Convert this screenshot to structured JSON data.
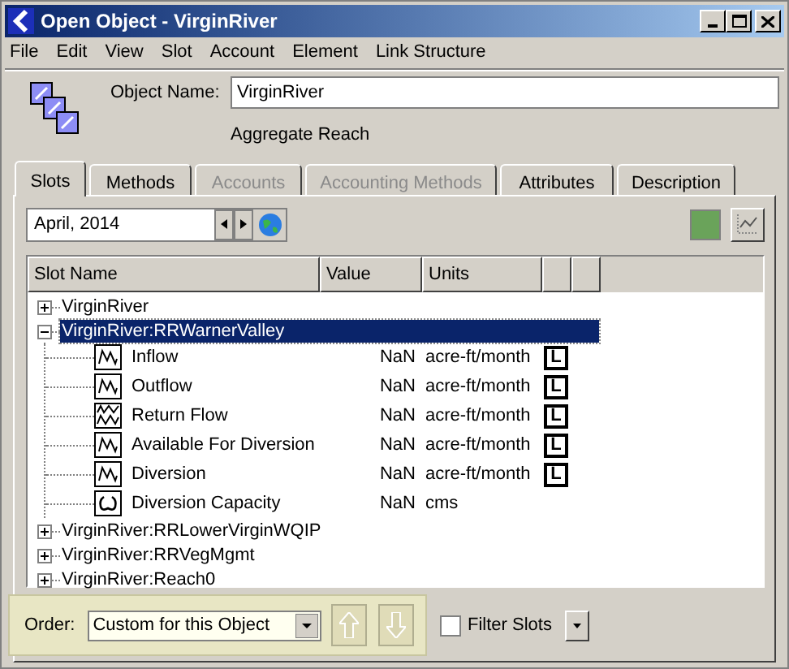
{
  "window": {
    "title": "Open Object - VirginRiver"
  },
  "menu": [
    "File",
    "Edit",
    "View",
    "Slot",
    "Account",
    "Element",
    "Link Structure"
  ],
  "object_name": {
    "label": "Object Name:",
    "value": "VirginRiver"
  },
  "object_type": "Aggregate Reach",
  "tabs": [
    {
      "label": "Slots",
      "selected": true,
      "disabled": false
    },
    {
      "label": "Methods",
      "selected": false,
      "disabled": false
    },
    {
      "label": "Accounts",
      "selected": false,
      "disabled": true
    },
    {
      "label": "Accounting Methods",
      "selected": false,
      "disabled": true
    },
    {
      "label": "Attributes",
      "selected": false,
      "disabled": false
    },
    {
      "label": "Description",
      "selected": false,
      "disabled": false
    }
  ],
  "date": "April, 2014",
  "tree": {
    "columns": [
      "Slot Name",
      "Value",
      "Units"
    ],
    "items": [
      {
        "label": "VirginRiver",
        "expanded": false,
        "selected": false
      },
      {
        "label": "VirginRiver:RRWarnerValley",
        "expanded": true,
        "selected": true,
        "children": [
          {
            "label": "Inflow",
            "kind": "series",
            "value": "NaN",
            "units": "acre-ft/month",
            "flag": "L"
          },
          {
            "label": "Outflow",
            "kind": "series",
            "value": "NaN",
            "units": "acre-ft/month",
            "flag": "L"
          },
          {
            "label": "Return Flow",
            "kind": "multi",
            "value": "NaN",
            "units": "acre-ft/month",
            "flag": "L"
          },
          {
            "label": "Available For Diversion",
            "kind": "series",
            "value": "NaN",
            "units": "acre-ft/month",
            "flag": "L"
          },
          {
            "label": "Diversion",
            "kind": "series",
            "value": "NaN",
            "units": "acre-ft/month",
            "flag": "L"
          },
          {
            "label": "Diversion Capacity",
            "kind": "scalar",
            "value": "NaN",
            "units": "cms"
          }
        ]
      },
      {
        "label": "VirginRiver:RRLowerVirginWQIP",
        "expanded": false,
        "selected": false
      },
      {
        "label": "VirginRiver:RRVegMgmt",
        "expanded": false,
        "selected": false
      },
      {
        "label": "VirginRiver:Reach0",
        "expanded": false,
        "selected": false
      }
    ]
  },
  "order": {
    "label": "Order:",
    "value": "Custom for this Object"
  },
  "filter": {
    "label": "Filter Slots",
    "checked": false
  }
}
